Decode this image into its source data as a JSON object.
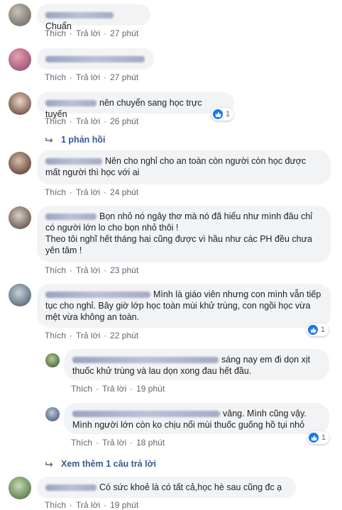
{
  "actions": {
    "like": "Thích",
    "reply": "Trả lời",
    "sep": "·"
  },
  "comments": [
    {
      "text": "Chuẩn",
      "time": "27 phút"
    },
    {
      "text": "",
      "time": "27 phút"
    },
    {
      "text": "nên chuyển sang học trực tuyến",
      "time": "26 phút",
      "reactions": "1"
    },
    {
      "text": "Nên cho nghỉ cho an toàn còn người còn học được mất người thì học với ai",
      "time": "24 phút"
    },
    {
      "text": "Bọn nhỏ nó ngây thơ mà nó đã hiểu như mình đâu chỉ có người lớn lo cho bọn nhỏ thôi !",
      "text2": "Theo tôi nghĩ hết tháng hai cũng được vì hầu như các PH đều chưa yên tâm !",
      "time": "23 phút"
    },
    {
      "text": "Mình là giáo viên nhưng con mình vẫn tiếp tục cho nghỉ. Bây giờ lớp học toàn mùi khử trùng, con ngồi học vừa mệt vừa không an toàn.",
      "time": "22 phút",
      "reactions": "1"
    },
    {
      "text": "sáng nay em đi dọn xịt thuốc khử trùng và lau dọn xong đau hết đầu.",
      "time": "19 phút"
    },
    {
      "text": "vâng. Mình cũng vậy. Mình người lớn còn ko chịu nổi mùi thuốc guống hồ tụi nhỏ",
      "time": "18 phút",
      "reactions": "1"
    },
    {
      "text": "Có sức khoẻ là có tất cả,học hè sau cũng đc ạ",
      "time": "19 phút"
    }
  ],
  "replies": {
    "one": "1 phản hồi",
    "more": "Xem thêm 1 câu trả lời"
  },
  "colors": {
    "accent": "#1877f2",
    "link": "#385898",
    "bubble": "#f2f3f5",
    "meta": "#606770"
  }
}
